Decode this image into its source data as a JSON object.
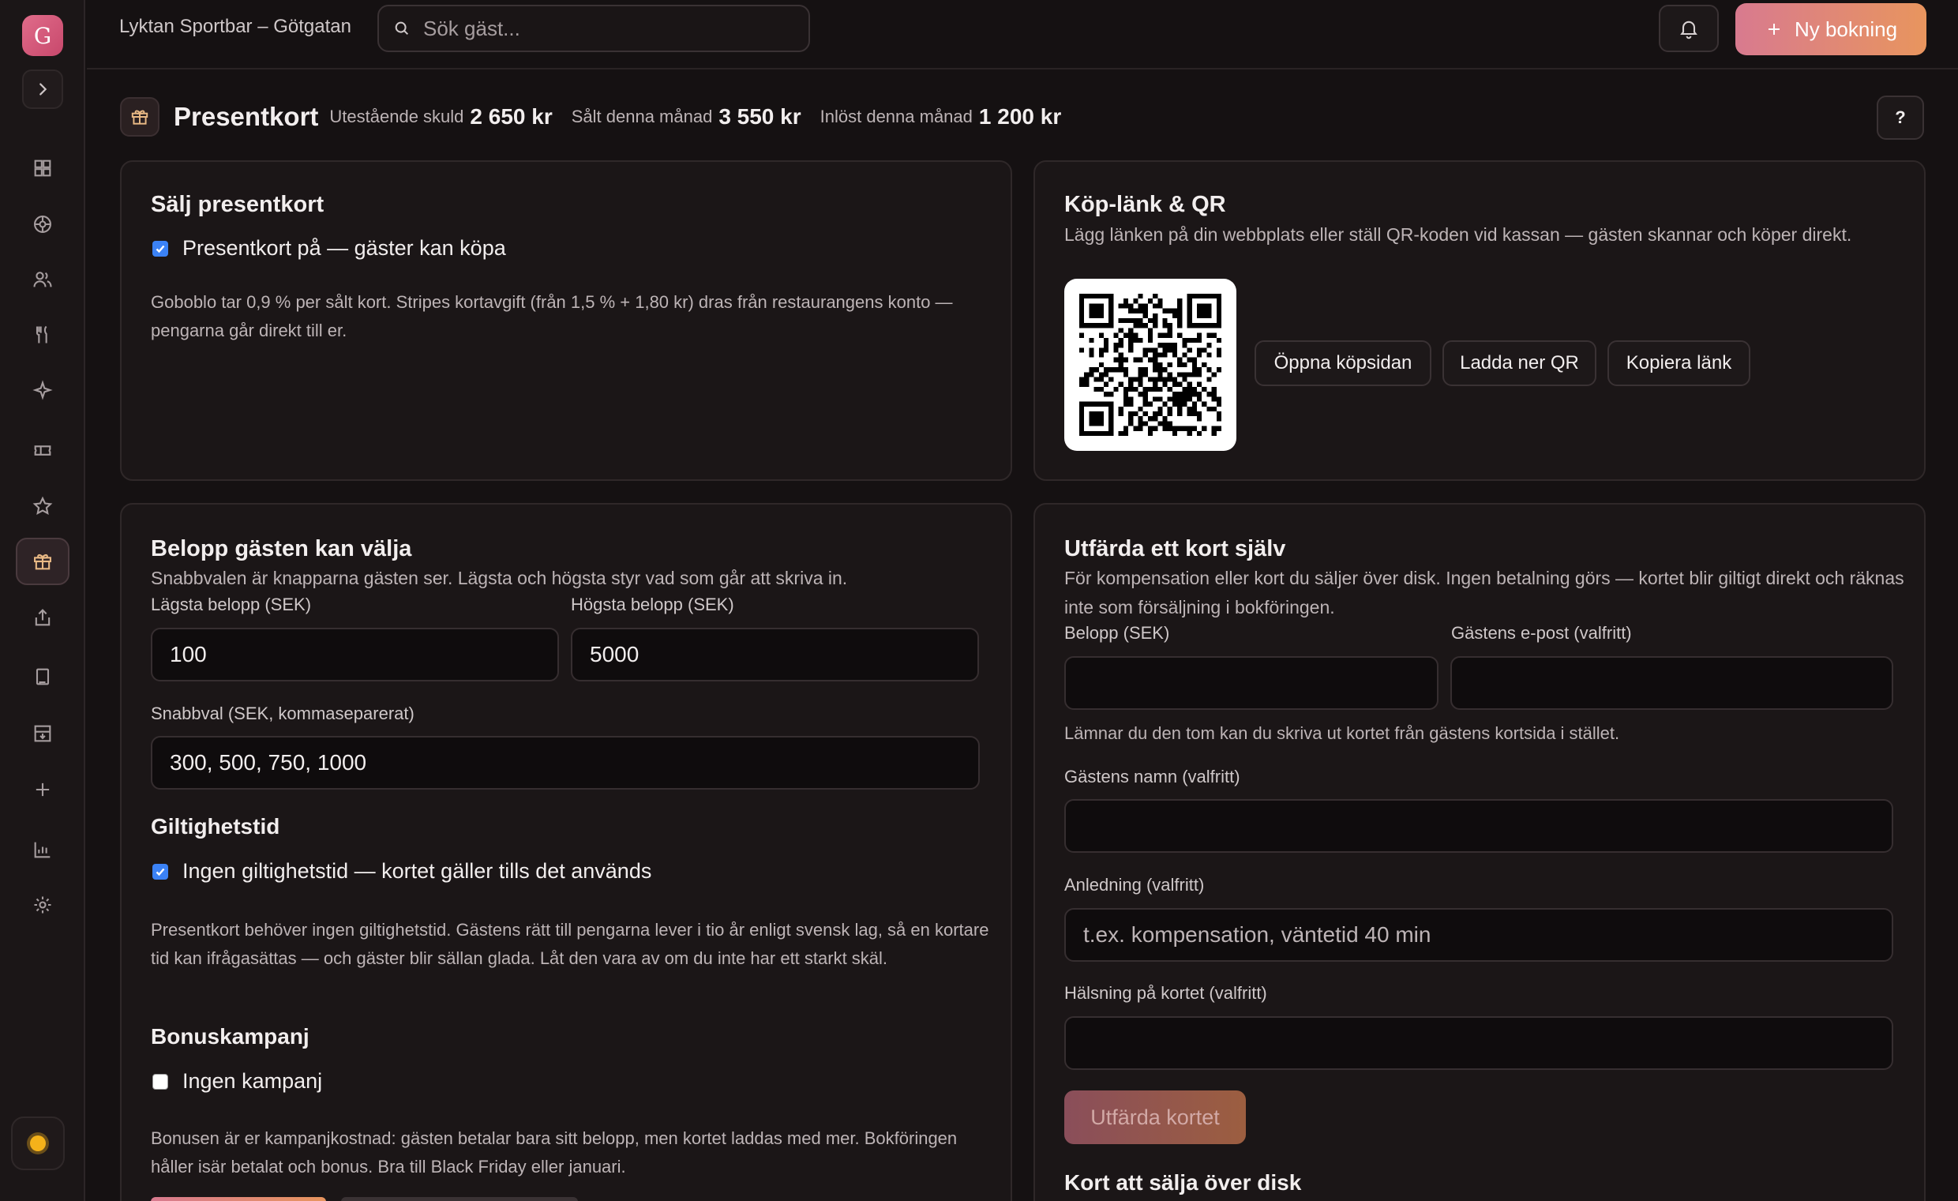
{
  "sidebar": {
    "logo_letter": "G",
    "icons": [
      "dashboard-icon",
      "floor-plan-icon",
      "guests-icon",
      "menu-icon",
      "sparkle-icon",
      "ticket-icon",
      "star-icon",
      "gift-icon",
      "share-icon",
      "book-icon",
      "archive-icon",
      "plus-icon",
      "chart-icon",
      "settings-icon"
    ],
    "active_icon": "gift-icon"
  },
  "topbar": {
    "venue": "Lyktan Sportbar – Götgatan",
    "search_placeholder": "Sök gäst...",
    "new_booking_label": "Ny bokning"
  },
  "header": {
    "title": "Presentkort",
    "stats": [
      {
        "label": "Utestående skuld",
        "value": "2 650 kr"
      },
      {
        "label": "Sålt denna månad",
        "value": "3 550 kr"
      },
      {
        "label": "Inlöst denna månad",
        "value": "1 200 kr"
      }
    ],
    "help_label": "?"
  },
  "sell": {
    "title": "Sälj presentkort",
    "toggle_label": "Presentkort på — gäster kan köpa",
    "toggle_checked": true,
    "fee_text": "Goboblo tar 0,9 % per sålt kort. Stripes kortavgift (från 1,5 % + 1,80 kr) dras från restaurangens konto — pengarna går direkt till er."
  },
  "link_qr": {
    "title": "Köp-länk & QR",
    "subtitle": "Lägg länken på din webbplats eller ställ QR-koden vid kassan — gästen skannar och köper direkt.",
    "buttons": [
      "Öppna köpsidan",
      "Ladda ner QR",
      "Kopiera länk"
    ]
  },
  "amounts": {
    "title": "Belopp gästen kan välja",
    "subtitle": "Snabbvalen är knapparna gästen ser. Lägsta och högsta styr vad som går att skriva in.",
    "min_label": "Lägsta belopp (SEK)",
    "min_value": "100",
    "max_label": "Högsta belopp (SEK)",
    "max_value": "5000",
    "quick_label": "Snabbval (SEK, kommaseparerat)",
    "quick_value": "300, 500, 750, 1000",
    "validity_title": "Giltighetstid",
    "validity_label": "Ingen giltighetstid — kortet gäller tills det används",
    "validity_checked": true,
    "validity_text": "Presentkort behöver ingen giltighetstid. Gästens rätt till pengarna lever i tio år enligt svensk lag, så en kortare tid kan ifrågasättas — och gäster blir sällan glada. Låt den vara av om du inte har ett starkt skäl.",
    "bonus_title": "Bonuskampanj",
    "bonus_label": "Ingen kampanj",
    "bonus_checked": false,
    "bonus_text": "Bonusen är er kampanjkostnad: gästen betalar bara sitt belopp, men kortet laddas med mer. Bokföringen håller isär betalat och bonus. Bra till Black Friday eller januari."
  },
  "issue": {
    "title": "Utfärda ett kort själv",
    "subtitle": "För kompensation eller kort du säljer över disk. Ingen betalning görs — kortet blir giltigt direkt och räknas inte som försäljning i bokföringen.",
    "amount_label": "Belopp (SEK)",
    "amount_value": "",
    "email_label": "Gästens e-post (valfritt)",
    "email_value": "",
    "email_hint": "Lämnar du den tom kan du skriva ut kortet från gästens kortsida i stället.",
    "name_label": "Gästens namn (valfritt)",
    "name_value": "",
    "reason_label": "Anledning (valfritt)",
    "reason_placeholder": "t.ex. kompensation, väntetid 40 min",
    "greeting_label": "Hälsning på kortet (valfritt)",
    "greeting_value": "",
    "issue_button": "Utfärda kortet",
    "counter_title": "Kort att sälja över disk"
  },
  "colors": {
    "accent_start": "#d87a8f",
    "accent_end": "#e8955e",
    "checkbox": "#3b82f6",
    "active_icon": "#e9b985"
  }
}
